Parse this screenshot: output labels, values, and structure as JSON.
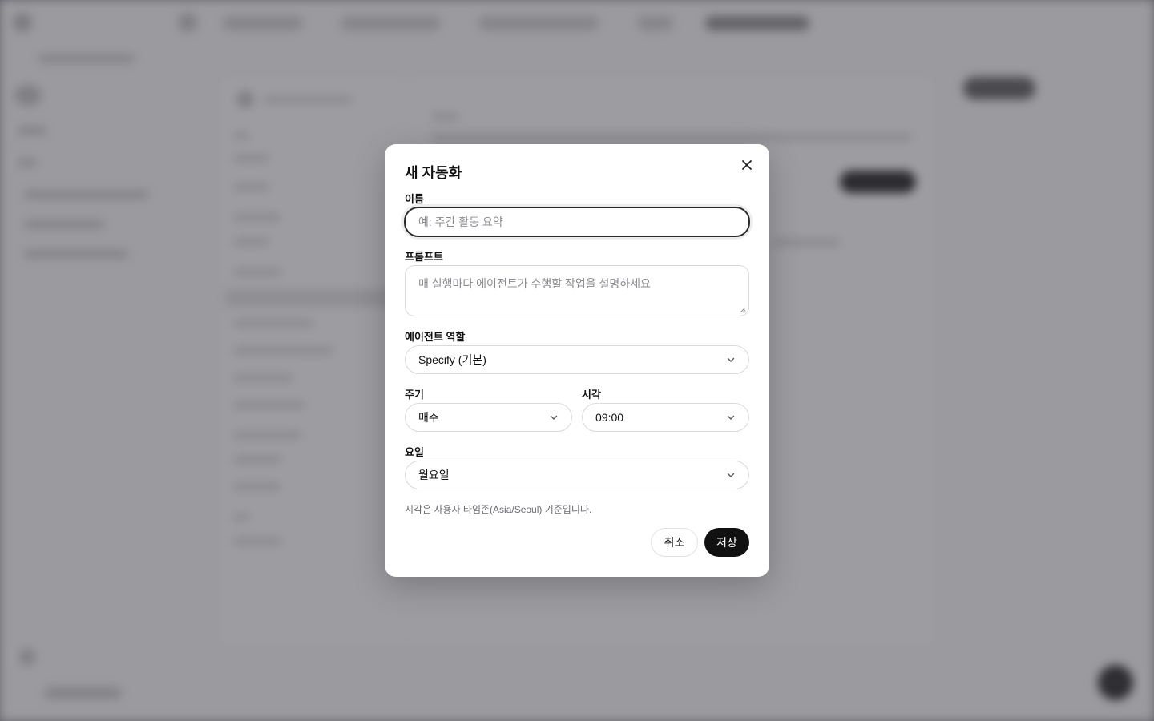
{
  "modal": {
    "title": "새 자동화",
    "name": {
      "label": "이름",
      "placeholder": "예: 주간 활동 요약",
      "value": ""
    },
    "prompt": {
      "label": "프롬프트",
      "placeholder": "매 실행마다 에이전트가 수행할 작업을 설명하세요",
      "value": ""
    },
    "role": {
      "label": "에이전트 역할",
      "selected": "Specify (기본)"
    },
    "frequency": {
      "label": "주기",
      "selected": "매주"
    },
    "time": {
      "label": "시각",
      "selected": "09:00"
    },
    "weekday": {
      "label": "요일",
      "selected": "월요일"
    },
    "hint": "시각은 사용자 타임존(Asia/Seoul) 기준입니다.",
    "cancel_label": "취소",
    "save_label": "저장"
  },
  "icons": {
    "close": "close-icon",
    "chevron": "chevron-down-icon",
    "resize": "resize-grip-icon"
  },
  "colors": {
    "overlay": "#3c3c43",
    "primary_button": "#111111",
    "focus_border": "#2b2b2b",
    "hint_text": "#6b6b72"
  }
}
